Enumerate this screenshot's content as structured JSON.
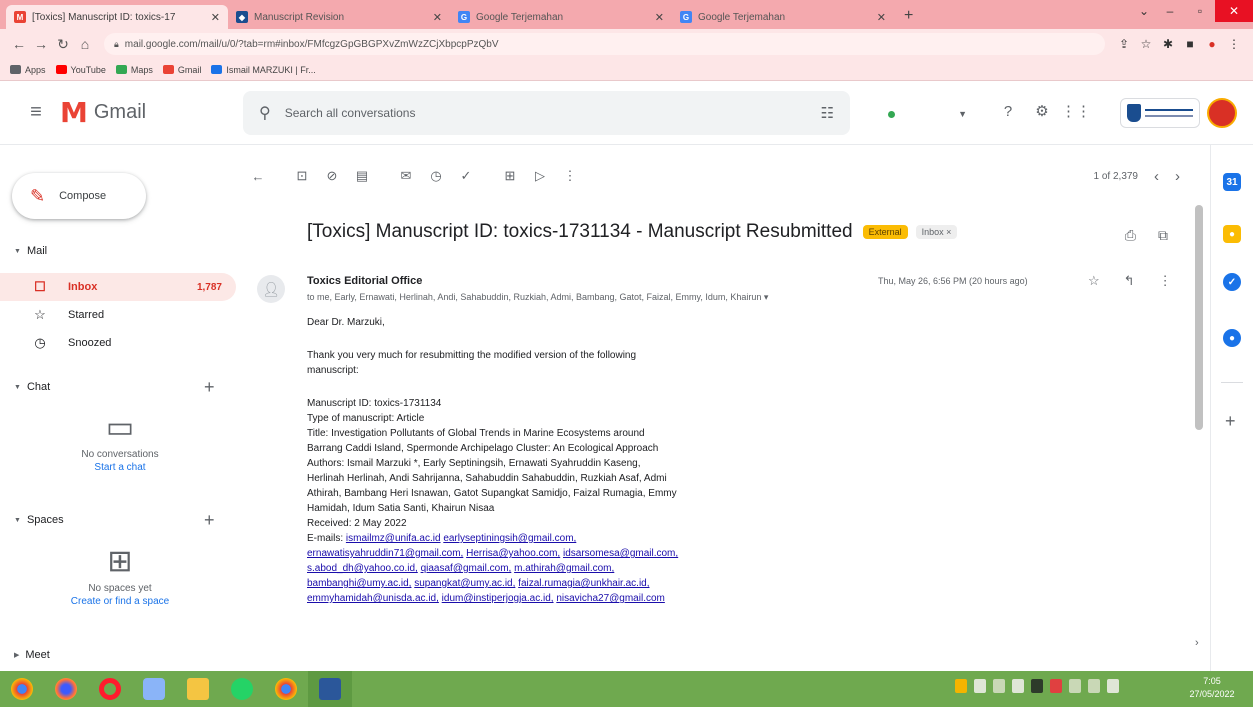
{
  "browser": {
    "tabs": [
      {
        "title": "[Toxics] Manuscript ID: toxics-17",
        "icon": "gmail-favicon",
        "active": true
      },
      {
        "title": "Manuscript Revision",
        "icon": "mdpi-favicon",
        "active": false
      },
      {
        "title": "Google Terjemahan",
        "icon": "translate-favicon",
        "active": false
      },
      {
        "title": "Google Terjemahan",
        "icon": "translate-favicon",
        "active": false
      }
    ],
    "url": "mail.google.com/mail/u/0/?tab=rm#inbox/FMfcgzGpGBGPXvZmWzZCjXbpcpPzQbV",
    "bookmarks": [
      {
        "label": "Apps",
        "color": "#5f6368"
      },
      {
        "label": "YouTube",
        "color": "#ff0000"
      },
      {
        "label": "Maps",
        "color": "#34a853"
      },
      {
        "label": "Gmail",
        "color": "#ea4335"
      },
      {
        "label": "Ismail MARZUKI | Fr...",
        "color": "#1a73e8"
      }
    ]
  },
  "gmail": {
    "logo_text": "Gmail",
    "search_placeholder": "Search all conversations",
    "compose_label": "Compose",
    "mail_section": "Mail",
    "nav": [
      {
        "label": "Inbox",
        "count": "1,787",
        "icon": "inbox-icon",
        "glyph": "☐"
      },
      {
        "label": "Starred",
        "count": "",
        "icon": "star-icon",
        "glyph": "☆"
      },
      {
        "label": "Snoozed",
        "count": "",
        "icon": "clock-icon",
        "glyph": "◷"
      }
    ],
    "chat_section": "Chat",
    "chat_empty": "No conversations",
    "chat_link": "Start a chat",
    "spaces_section": "Spaces",
    "spaces_empty": "No spaces yet",
    "spaces_link": "Create or find a space",
    "meet_section": "Meet"
  },
  "toolbar": {
    "pager_text": "1 of 2,379"
  },
  "email": {
    "subject": "[Toxics] Manuscript ID: toxics-1731134 - Manuscript Resubmitted",
    "label_external": "External",
    "label_inbox": "Inbox ×",
    "sender": "Toxics Editorial Office",
    "recipients": "to me, Early, Ernawati, Herlinah, Andi, Sahabuddin, Ruzkiah, Admi, Bambang, Gatot, Faizal, Emmy, Idum, Khairun ▾",
    "date": "Thu, May 26, 6:56 PM (20 hours ago)",
    "greeting": "Dear Dr. Marzuki,",
    "intro_1": "Thank you very much for resubmitting the modified version of the following",
    "intro_2": "manuscript:",
    "ms_id": "Manuscript ID: toxics-1731134",
    "ms_type": "Type of manuscript: Article",
    "title_1": "Title: Investigation Pollutants of Global Trends in Marine Ecosystems around",
    "title_2": "Barrang Caddi Island, Spermonde Archipelago Cluster: An Ecological Approach",
    "authors_1": "Authors: Ismail Marzuki *, Early Septiningsih, Ernawati Syahruddin Kaseng,",
    "authors_2": "Herlinah Herlinah, Andi Sahrijanna, Sahabuddin Sahabuddin, Ruzkiah Asaf, Admi",
    "authors_3": "Athirah, Bambang Heri Isnawan, Gatot Supangkat Samidjo, Faizal Rumagia, Emmy",
    "authors_4": "Hamidah, Idum Satia Santi, Khairun Nisaa",
    "received": "Received: 2 May 2022",
    "emails_label": "E-mails:",
    "emails": [
      [
        "ismailmz@unifa.ac.id",
        "earlyseptiningsih@gmail.com,"
      ],
      [
        "ernawatisyahruddin71@gmail.com,",
        "Herrisa@yahoo.com,",
        "idsarsomesa@gmail.com,"
      ],
      [
        "s.abod_dh@yahoo.co.id,",
        "qiaasaf@gmail.com,",
        "m.athirah@gmail.com,"
      ],
      [
        "bambanghi@umy.ac.id,",
        "supangkat@umy.ac.id,",
        "faizal.rumagia@unkhair.ac.id,"
      ],
      [
        "emmyhamidah@unisda.ac.id,",
        "idum@instiperjogja.ac.id,",
        "nisavicha27@gmail.com"
      ]
    ]
  },
  "taskbar": {
    "time": "7:05",
    "date": "27/05/2022"
  }
}
